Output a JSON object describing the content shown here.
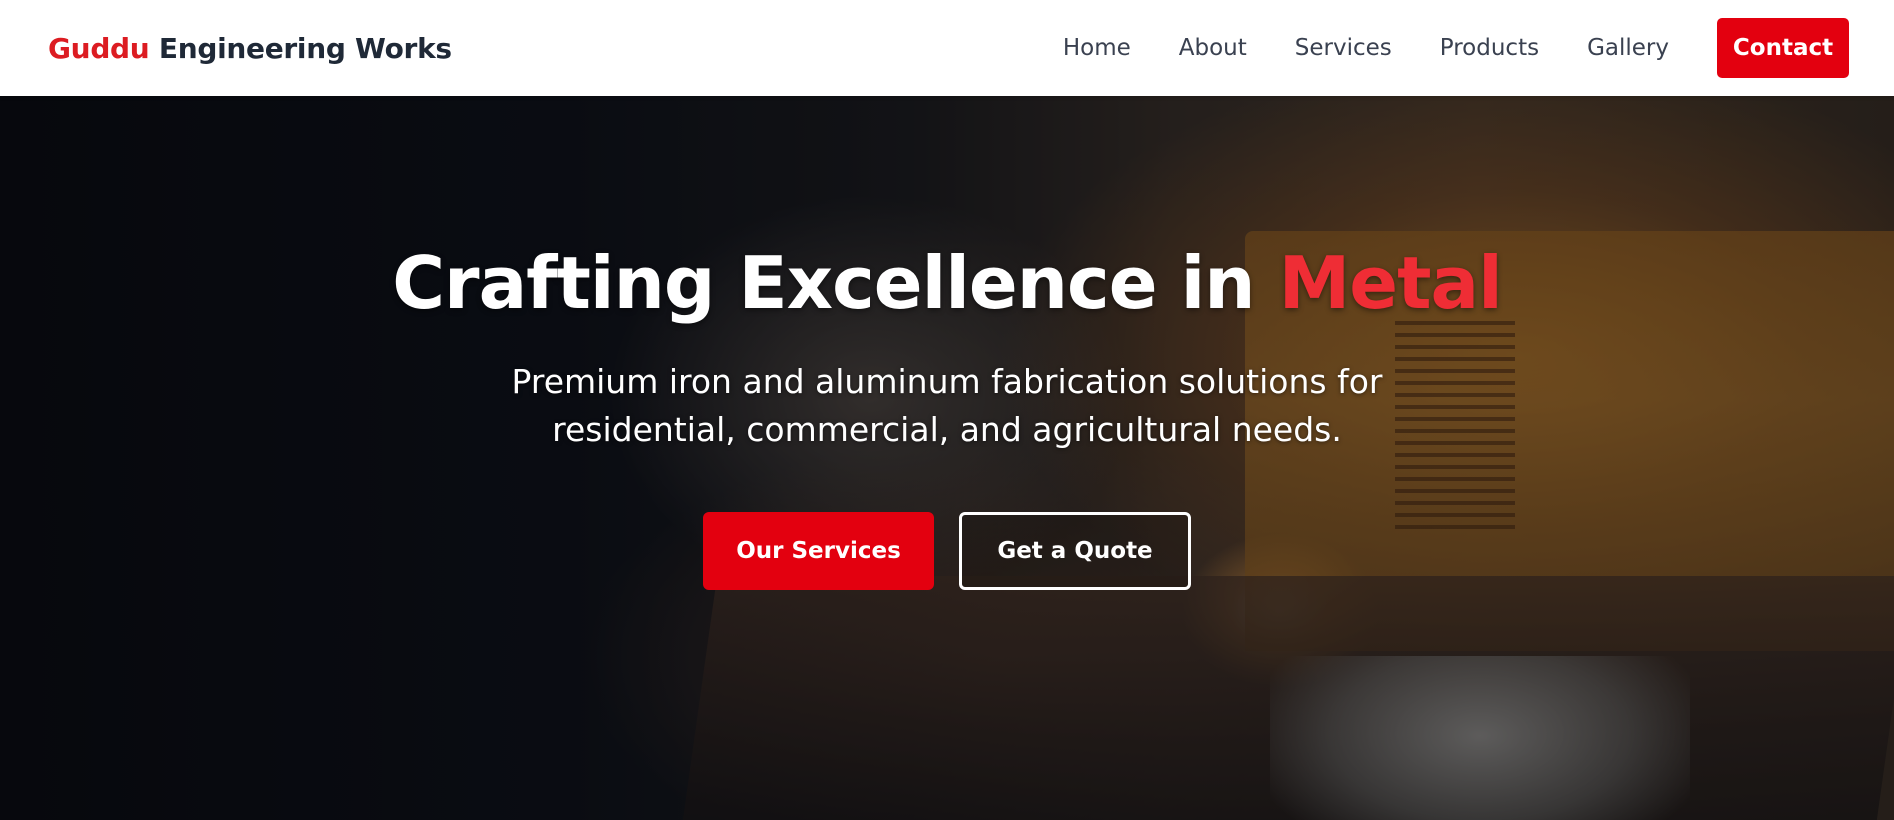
{
  "brand": {
    "accent": "Guddu",
    "rest": " Engineering Works"
  },
  "nav": {
    "items": [
      "Home",
      "About",
      "Services",
      "Products",
      "Gallery"
    ],
    "contact_label": "Contact"
  },
  "hero": {
    "title_main": "Crafting Excellence in ",
    "title_accent": "Metal",
    "subtitle": "Premium iron and aluminum fabrication solutions for residential, commercial, and agricultural needs.",
    "primary_button": "Our Services",
    "secondary_button": "Get a Quote"
  },
  "colors": {
    "accent": "#e3000f",
    "brand_text": "#1f2937",
    "nav_text": "#3a4150"
  }
}
